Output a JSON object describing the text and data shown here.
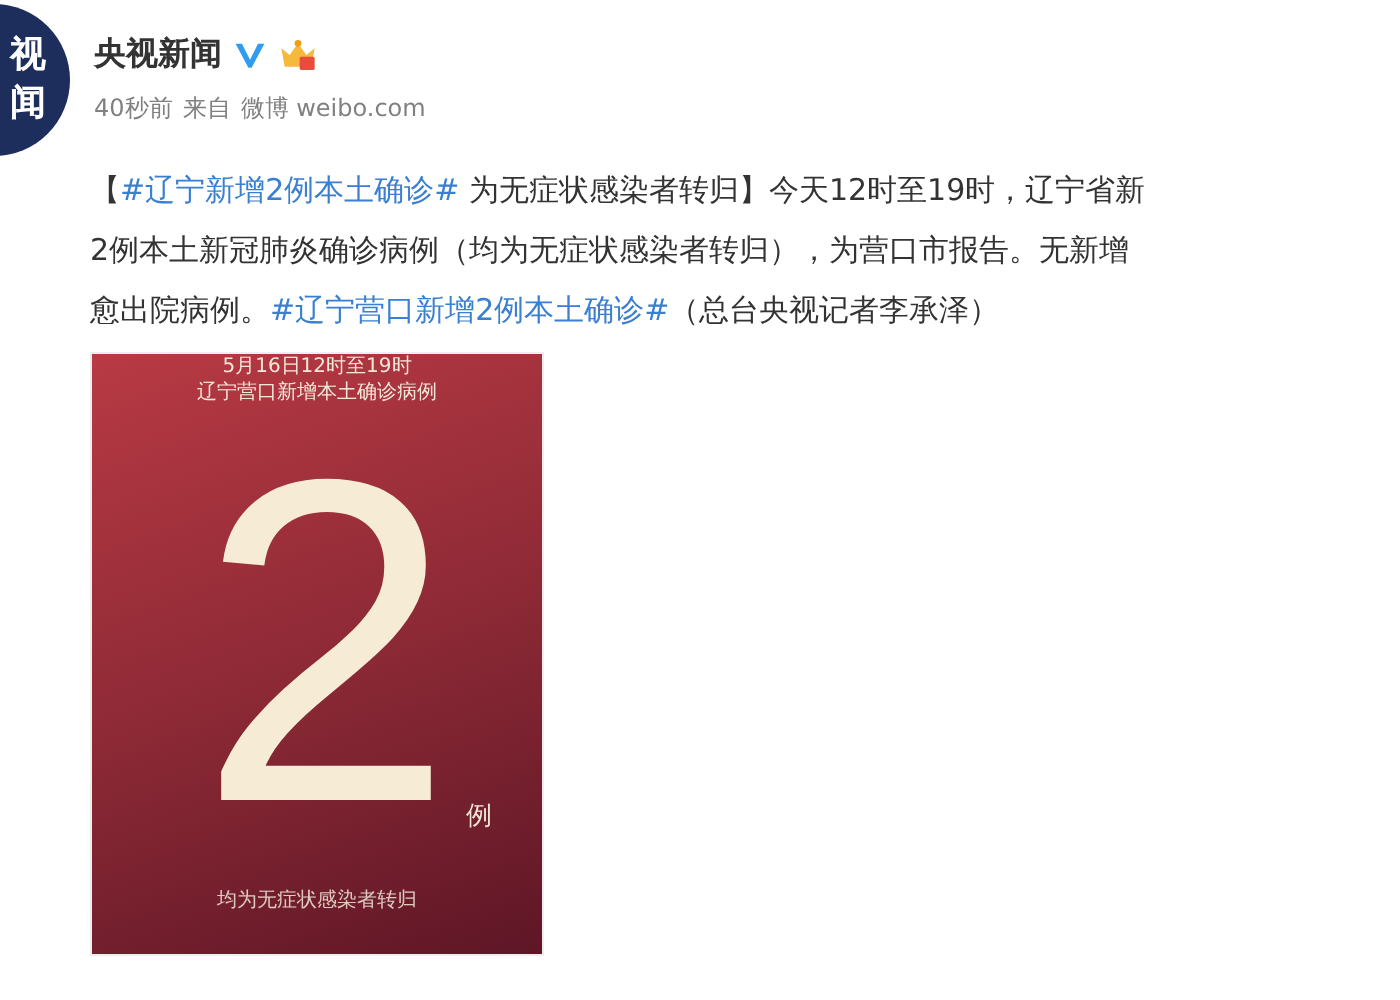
{
  "account": {
    "avatar_text": [
      "视",
      "闻"
    ],
    "name": "央视新闻",
    "meta": [
      "40秒前",
      "来自",
      "微博 weibo.com"
    ]
  },
  "post": {
    "lines": [
      [
        {
          "kind": "plain",
          "text": "【"
        },
        {
          "kind": "hashtag",
          "text": "#辽宁新增2例本土确诊#"
        },
        {
          "kind": "plain",
          "text": " 为无症状感染者转归】今天12时至19时，辽宁省新"
        }
      ],
      [
        {
          "kind": "plain",
          "text": "2例本土新冠肺炎确诊病例（均为无症状感染者转归），为营口市报告。无新增"
        }
      ],
      [
        {
          "kind": "plain",
          "text": "愈出院病例。"
        },
        {
          "kind": "hashtag",
          "text": "#辽宁营口新增2例本土确诊#"
        },
        {
          "kind": "plain",
          "text": "（总台央视记者李承泽）"
        }
      ]
    ]
  },
  "image": {
    "heading": [
      "5月16日12时至19时",
      "辽宁营口新增本土确诊病例"
    ],
    "number": "2",
    "unit": "例",
    "footnote": "均为无症状感染者转归"
  }
}
